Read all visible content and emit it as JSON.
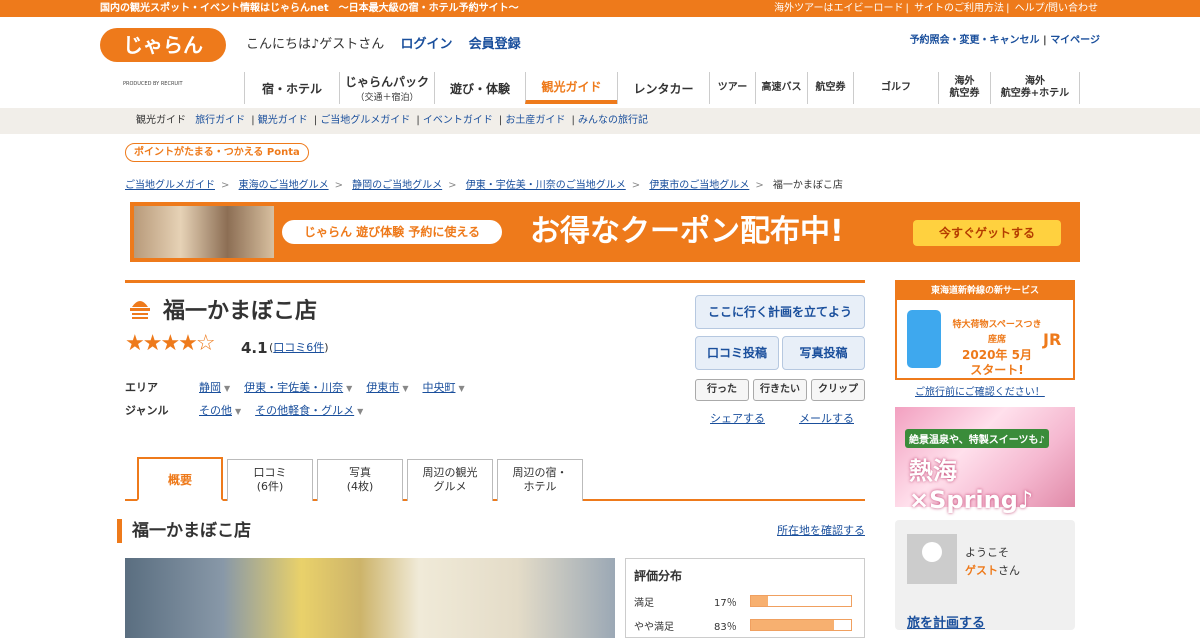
{
  "topbar": {
    "left": "国内の観光スポット・イベント情報はじゃらんnet　～日本最大級の宿・ホテル予約サイト～",
    "links": [
      "海外ツアーはエイビーロード",
      "サイトのご利用方法",
      "ヘルプ/問い合わせ"
    ]
  },
  "header": {
    "logo": "じゃらん",
    "produced_by": "PRODUCED BY RECRUIT",
    "greeting": "こんにちは♪ゲストさん",
    "login": "ログイン",
    "register": "会員登録",
    "links": [
      "予約照会・変更・キャンセル",
      "マイページ"
    ]
  },
  "gnav": [
    {
      "label": "宿・ホテル"
    },
    {
      "label": "じゃらんパック",
      "sub": "（交通＋宿泊）"
    },
    {
      "label": "遊び・体験"
    },
    {
      "label": "観光ガイド"
    },
    {
      "label": "レンタカー"
    },
    {
      "label": "ツアー"
    },
    {
      "label": "高速バス"
    },
    {
      "label": "航空券"
    },
    {
      "label": "ゴルフ"
    },
    {
      "label": "海外",
      "sub": "航空券"
    },
    {
      "label": "海外",
      "sub": "航空券+ホテル"
    }
  ],
  "subnav": [
    "観光ガイド",
    "旅行ガイド",
    "観光ガイド",
    "ご当地グルメガイド",
    "イベントガイド",
    "お土産ガイド",
    "みんなの旅行記"
  ],
  "ponta": "ポイントがたまる・つかえる Ponta",
  "breadcrumb": [
    "ご当地グルメガイド",
    "東海のご当地グルメ",
    "静岡のご当地グルメ",
    "伊東・宇佐美・川奈のご当地グルメ",
    "伊東市のご当地グルメ",
    "福一かまぼこ店"
  ],
  "banner": {
    "tag": "じゃらん 遊び体験 予約に使える",
    "headline": "お得なクーポン配布中!",
    "cta": "今すぐゲットする"
  },
  "shop": {
    "name": "福一かまぼこ店",
    "stars": "★★★★☆",
    "score": "4.1",
    "reviews": "口コミ6件",
    "area_label": "エリア",
    "area": [
      "静岡",
      "伊東・宇佐美・川奈",
      "伊東市",
      "中央町"
    ],
    "genre_label": "ジャンル",
    "genre": [
      "その他",
      "その他軽食・グルメ"
    ]
  },
  "actions": {
    "plan": "ここに行く計画を立てよう",
    "review": "口コミ投稿",
    "photo": "写真投稿",
    "went": "行った",
    "want": "行きたい",
    "clip": "クリップ",
    "share": "シェアする",
    "mail": "メールする"
  },
  "tabs": [
    {
      "label": "概要"
    },
    {
      "label": "口コミ",
      "sub": "(6件)"
    },
    {
      "label": "写真",
      "sub": "(4枚)"
    },
    {
      "label": "周辺の観光",
      "sub": "グルメ"
    },
    {
      "label": "周辺の宿・",
      "sub": "ホテル"
    }
  ],
  "section": {
    "title": "福一かまぼこ店",
    "location_link": "所在地を確認する"
  },
  "rating": {
    "heading": "評価分布",
    "rows": [
      {
        "label": "満足",
        "pct": "17％",
        "value": 17
      },
      {
        "label": "やや満足",
        "pct": "83％",
        "value": 83
      }
    ]
  },
  "sidebar": {
    "jr_header": "東海道新幹線の新サービス",
    "jr_sub": "特大荷物スペースつき座席",
    "jr_main": "2020年 5月",
    "jr_start": "スタート!",
    "jr_logo": "JR",
    "jr_note": "ご旅行前にご確認ください！",
    "atami_sub": "絶景温泉や、特製スイーツも♪",
    "atami_main": "熱海×Spring♪",
    "welcome": "ようこそ",
    "guest": "ゲスト",
    "san": "さん",
    "plan": "旅を計画する"
  }
}
